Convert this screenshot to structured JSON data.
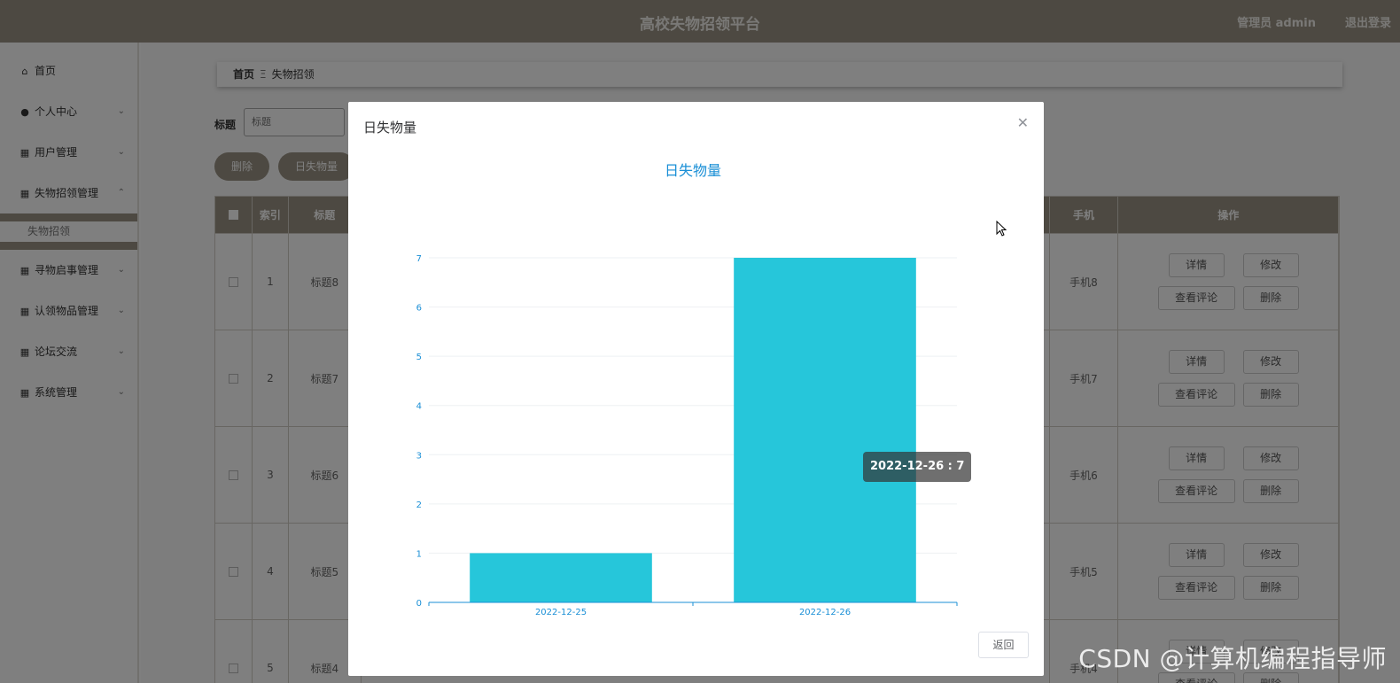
{
  "header": {
    "title": "高校失物招领平台",
    "user_label": "管理员 admin",
    "logout_label": "退出登录"
  },
  "sidebar": {
    "items": [
      {
        "label": "首页",
        "icon": "home-icon",
        "glyph": "⌂"
      },
      {
        "label": "个人中心",
        "icon": "user-icon",
        "glyph": "●"
      },
      {
        "label": "用户管理",
        "icon": "grid-icon",
        "glyph": "▦"
      },
      {
        "label": "失物招领管理",
        "icon": "grid-icon",
        "glyph": "▦",
        "expanded": true
      },
      {
        "label": "寻物启事管理",
        "icon": "grid-icon",
        "glyph": "▦"
      },
      {
        "label": "认领物品管理",
        "icon": "grid-icon",
        "glyph": "▦"
      },
      {
        "label": "论坛交流",
        "icon": "grid-icon",
        "glyph": "▦"
      },
      {
        "label": "系统管理",
        "icon": "grid-icon",
        "glyph": "▦"
      }
    ],
    "submenu": {
      "label": "失物招领"
    }
  },
  "breadcrumb": {
    "home": "首页",
    "separator": "Ξ",
    "current": "失物招领"
  },
  "search": {
    "label": "标题",
    "placeholder": "标题"
  },
  "toolbar": {
    "delete_label": "删除",
    "daily_label": "日失物量"
  },
  "table": {
    "headers": {
      "index": "索引",
      "title": "标题",
      "phone": "手机",
      "ops": "操作"
    },
    "rows": [
      {
        "index": "1",
        "title": "标题8",
        "phone": "手机8"
      },
      {
        "index": "2",
        "title": "标题7",
        "phone": "手机7"
      },
      {
        "index": "3",
        "title": "标题6",
        "phone": "手机6"
      },
      {
        "index": "4",
        "title": "标题5",
        "phone": "手机5"
      },
      {
        "index": "5",
        "title": "标题4",
        "phone": "手机4"
      }
    ],
    "ops": {
      "detail": "详情",
      "edit": "修改",
      "comments": "查看评论",
      "delete": "删除"
    }
  },
  "modal": {
    "title": "日失物量",
    "back_label": "返回",
    "tooltip": "2022-12-26 : 7"
  },
  "chart_data": {
    "type": "bar",
    "title": "日失物量",
    "categories": [
      "2022-12-25",
      "2022-12-26"
    ],
    "values": [
      1,
      7
    ],
    "ylim": [
      0,
      7
    ],
    "yticks": [
      0,
      1,
      2,
      3,
      4,
      5,
      6,
      7
    ],
    "grid": true,
    "colors": {
      "bar": "#26c6da",
      "axis": "#1a8fd6",
      "title": "#1a8fd6"
    }
  },
  "watermark": "CSDN @计算机编程指导师"
}
